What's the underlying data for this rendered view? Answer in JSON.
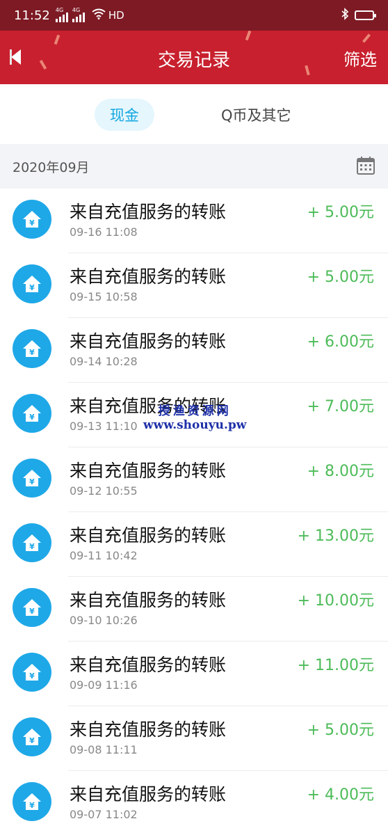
{
  "status_bar": {
    "time": "11:52",
    "network_1": "4G",
    "network_2": "4G",
    "hd": "HD",
    "wifi_icon": "wifi-icon",
    "bluetooth_icon": "bluetooth-icon",
    "battery_icon": "battery-icon",
    "battery_level": 0.8
  },
  "header": {
    "title": "交易记录",
    "filter_label": "筛选",
    "back_icon": "back-arrow-icon",
    "colors": {
      "bar": "#c8202e",
      "status": "#7d1a24"
    }
  },
  "tabs": [
    {
      "label": "现金",
      "active": true
    },
    {
      "label": "Q币及其它",
      "active": false
    }
  ],
  "month": {
    "label": "2020年09月",
    "calendar_icon": "calendar-icon"
  },
  "transactions": [
    {
      "title": "来自充值服务的转账",
      "time": "09-16 11:08",
      "amount": "+ 5.00元"
    },
    {
      "title": "来自充值服务的转账",
      "time": "09-15 10:58",
      "amount": "+ 5.00元"
    },
    {
      "title": "来自充值服务的转账",
      "time": "09-14 10:28",
      "amount": "+ 6.00元"
    },
    {
      "title": "来自充值服务的转账",
      "time": "09-13 11:10",
      "amount": "+ 7.00元"
    },
    {
      "title": "来自充值服务的转账",
      "time": "09-12 10:55",
      "amount": "+ 8.00元"
    },
    {
      "title": "来自充值服务的转账",
      "time": "09-11 10:42",
      "amount": "+ 13.00元"
    },
    {
      "title": "来自充值服务的转账",
      "time": "09-10 10:26",
      "amount": "+ 10.00元"
    },
    {
      "title": "来自充值服务的转账",
      "time": "09-09 11:16",
      "amount": "+ 11.00元"
    },
    {
      "title": "来自充值服务的转账",
      "time": "09-08 11:11",
      "amount": "+ 5.00元"
    },
    {
      "title": "来自充值服务的转账",
      "time": "09-07 11:02",
      "amount": "+ 4.00元"
    }
  ],
  "row_icon": "yuan-house-icon",
  "accent_colors": {
    "amount": "#4cbb58",
    "tab_active": "#11a7e0",
    "icon_bg": "#1ea8e8"
  },
  "watermark": {
    "line1": "授渔资源网",
    "line2": "www.shouyu.pw"
  }
}
